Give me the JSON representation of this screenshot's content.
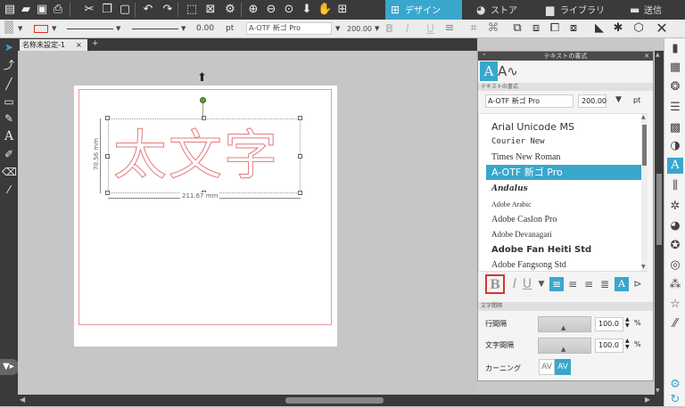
{
  "nav": {
    "tabs": [
      {
        "label": "デザイン"
      },
      {
        "label": "ストア"
      },
      {
        "label": "ライブラリ"
      },
      {
        "label": "送信"
      }
    ]
  },
  "options": {
    "line_width": "0.00",
    "line_unit": "pt",
    "font_name": "A-OTF 新ゴ Pro",
    "font_size": "200.00",
    "bold": "B",
    "italic": "I",
    "underline": "U"
  },
  "document": {
    "tab_label": "名称未設定-1",
    "close": "×",
    "add": "+",
    "text": "太文字",
    "width_label": "211.67 mm",
    "height_label": "70.56 mm"
  },
  "panel": {
    "title": "テキストの書式",
    "section_style": "テキストの書式",
    "font_field": "A-OTF 新ゴ Pro",
    "size_field": "200.00",
    "size_unit": "pt",
    "fonts": [
      "Arial Unicode MS",
      "Courier New",
      "Times New Roman",
      "A-OTF 新ゴ Pro",
      "Andalus",
      "Adobe Arabic",
      "Adobe Caslon Pro",
      "Adobe Devanagari",
      "Adobe Fan Heiti Std",
      "Adobe Fangsong Std"
    ],
    "selected_font_index": 3,
    "bold": "B",
    "italic": "I",
    "underline": "U",
    "section_spacing": "文字間隔",
    "line_spacing_label": "行間隔",
    "line_spacing_value": "100.0",
    "char_spacing_label": "文字間隔",
    "char_spacing_value": "100.0",
    "percent": "%",
    "kerning_label": "カーニング",
    "kerning_glyph": "AV"
  },
  "colors": {
    "accent": "#39a7cc",
    "dark": "#3a3a3a",
    "outline_pink": "#e59a9a",
    "highlight_red": "#d9352b"
  }
}
